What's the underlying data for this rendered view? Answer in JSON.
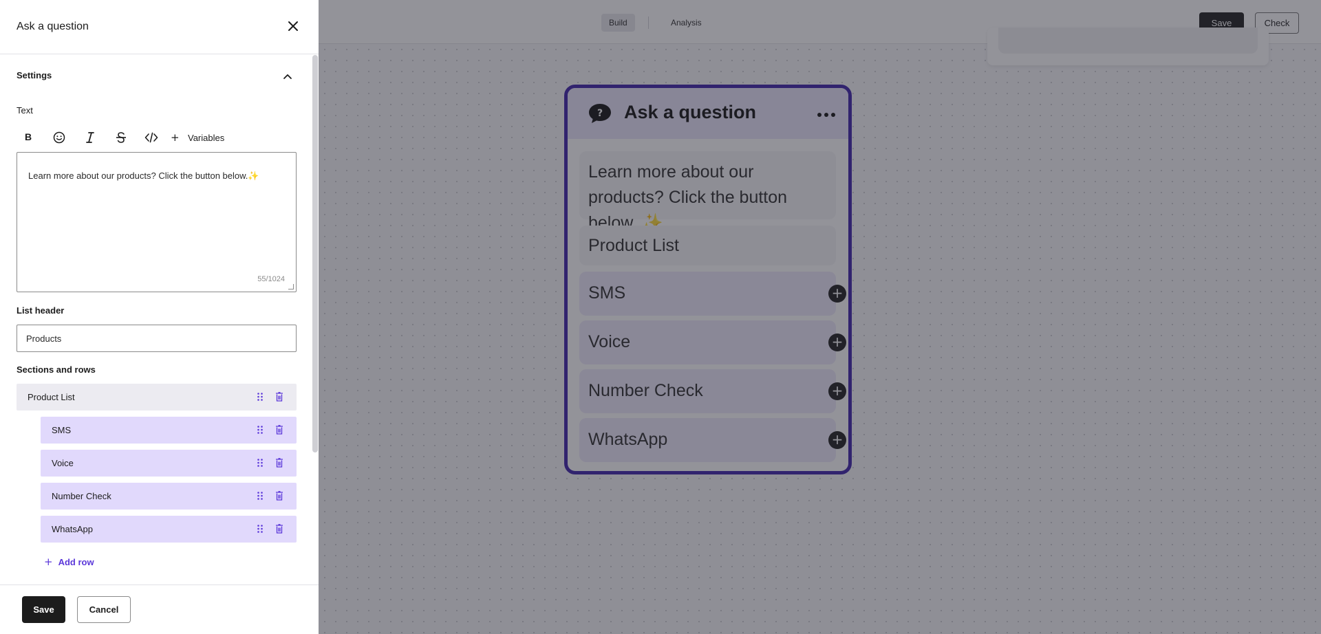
{
  "canvas": {
    "tabs": [
      {
        "label": "Build",
        "active": true
      },
      {
        "label": "Analysis",
        "active": false
      }
    ],
    "save_label": "Save",
    "check_label": "Check",
    "node": {
      "title": "Ask a question",
      "message": "Learn more about our products? Click the button below.",
      "message_emoji": "✨",
      "list_title": "Product List",
      "rows": [
        "SMS",
        "Voice",
        "Number Check",
        "WhatsApp"
      ]
    }
  },
  "panel": {
    "title": "Ask a question",
    "settings_title": "Settings",
    "text_label": "Text",
    "toolbar": {
      "bold": "B",
      "variables_label": "Variables",
      "icons": [
        "bold-icon",
        "emoji-icon",
        "italic-icon",
        "strikethrough-icon",
        "code-icon",
        "plus-icon"
      ]
    },
    "text_value": "Learn more about our products? Click the button below.",
    "text_emoji": "✨",
    "char_count": "55/1024",
    "list_header_label": "List header",
    "list_header_value": "Products",
    "sections_label": "Sections and rows",
    "section": "Product List",
    "rows": [
      "SMS",
      "Voice",
      "Number Check",
      "WhatsApp"
    ],
    "add_row_label": "Add row",
    "save_label": "Save",
    "cancel_label": "Cancel"
  },
  "colors": {
    "accent": "#5b38d9",
    "node_border": "#3b1fa8",
    "row_bg": "#e1d9fc",
    "primary_button": "#1c1c1c"
  }
}
